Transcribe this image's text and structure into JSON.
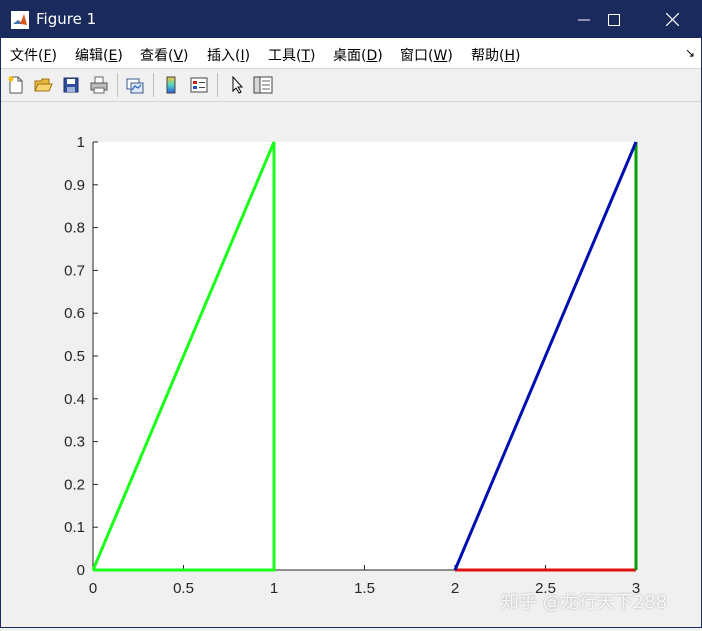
{
  "window": {
    "title": "Figure 1",
    "app_icon": "matlab-logo-icon",
    "controls": {
      "minimize": "minimize-icon",
      "maximize": "maximize-icon",
      "close": "close-icon"
    }
  },
  "menu": {
    "items": [
      {
        "label": "文件",
        "mnemonic": "F"
      },
      {
        "label": "编辑",
        "mnemonic": "E"
      },
      {
        "label": "查看",
        "mnemonic": "V"
      },
      {
        "label": "插入",
        "mnemonic": "I"
      },
      {
        "label": "工具",
        "mnemonic": "T"
      },
      {
        "label": "桌面",
        "mnemonic": "D"
      },
      {
        "label": "窗口",
        "mnemonic": "W"
      },
      {
        "label": "帮助",
        "mnemonic": "H"
      }
    ],
    "collapse_icon": "dock-arrow-icon"
  },
  "toolbar": {
    "buttons": [
      "new-figure-icon",
      "open-folder-icon",
      "save-icon",
      "print-icon",
      "link-plot-icon",
      "colorbar-icon",
      "legend-icon",
      "pointer-icon",
      "property-editor-icon"
    ]
  },
  "chart_data": {
    "type": "line",
    "title": "",
    "xlabel": "",
    "ylabel": "",
    "xlim": [
      0,
      3
    ],
    "ylim": [
      0,
      1
    ],
    "xticks": [
      "0",
      "0.5",
      "1",
      "1.5",
      "2",
      "2.5",
      "3"
    ],
    "yticks": [
      "0",
      "0.1",
      "0.2",
      "0.3",
      "0.4",
      "0.5",
      "0.6",
      "0.7",
      "0.8",
      "0.9",
      "1"
    ],
    "grid": false,
    "series": [
      {
        "color": "#1aff1a",
        "x": [
          0,
          1,
          1,
          0
        ],
        "y": [
          0,
          1,
          0,
          0
        ]
      },
      {
        "color": "#e01010",
        "x": [
          2,
          3
        ],
        "y": [
          0,
          0
        ]
      },
      {
        "color": "#00a000",
        "x": [
          3,
          3
        ],
        "y": [
          0,
          1
        ]
      },
      {
        "color": "#0010b0",
        "x": [
          2,
          3
        ],
        "y": [
          0,
          1
        ]
      }
    ]
  },
  "watermark": "知乎 @龙行天下288"
}
